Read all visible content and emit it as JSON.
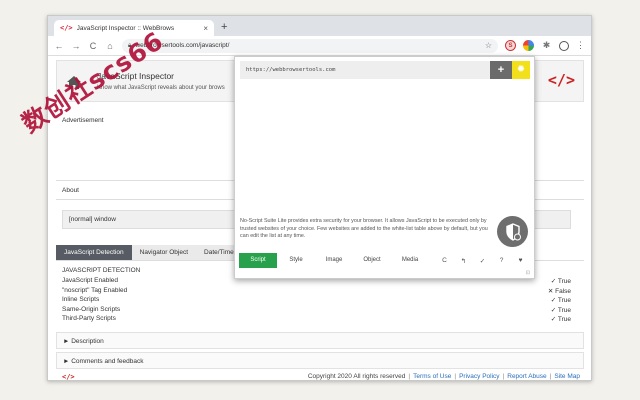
{
  "browser": {
    "tab": {
      "icon": "</>",
      "title": "JavaScript Inspector :: WebBrows",
      "close": "×"
    },
    "new_tab": "+",
    "address": "webbrowsertools.com/javascript/"
  },
  "page": {
    "title": "JavaScript Inspector",
    "subtitle": "Know what JavaScript reveals about your brows",
    "logo": "</>",
    "advertisement": "Advertisement",
    "about": "About",
    "window_value": "[normal] window",
    "tabs": [
      "JavaScript Detection",
      "Navigator Object",
      "Date/Time"
    ],
    "detection_title": "JAVASCRIPT DETECTION",
    "detections": [
      {
        "label": "JavaScript Enabled",
        "value": "✓ True"
      },
      {
        "label": "\"noscript\" Tag Enabled",
        "value": "✕ False"
      },
      {
        "label": "Inline Scripts",
        "value": "✓ True"
      },
      {
        "label": "Same-Origin Scripts",
        "value": "✓ True"
      },
      {
        "label": "Third-Party Scripts",
        "value": "✓ True"
      }
    ],
    "description": "► Description",
    "comments": "► Comments and feedback",
    "footer": {
      "logo": "</>",
      "copyright": "Copyright 2020 All rights reserved",
      "links": [
        "Terms of Use",
        "Privacy Policy",
        "Report Abuse",
        "Site Map"
      ]
    }
  },
  "popup": {
    "url": "https://webbrowsertools.com",
    "add": "+",
    "info": "No-Script Suite Lite provides extra security for your browser. It allows JavaScript to be executed only by trusted websites of your choice. Few websites are added to the white-list table above by default, but you can edit the list at any time.",
    "tabs": [
      "Script",
      "Style",
      "Image",
      "Object",
      "Media"
    ],
    "actions": [
      "C",
      "↰",
      "✓",
      "?",
      "♥"
    ]
  },
  "watermark": "数创社scs66"
}
